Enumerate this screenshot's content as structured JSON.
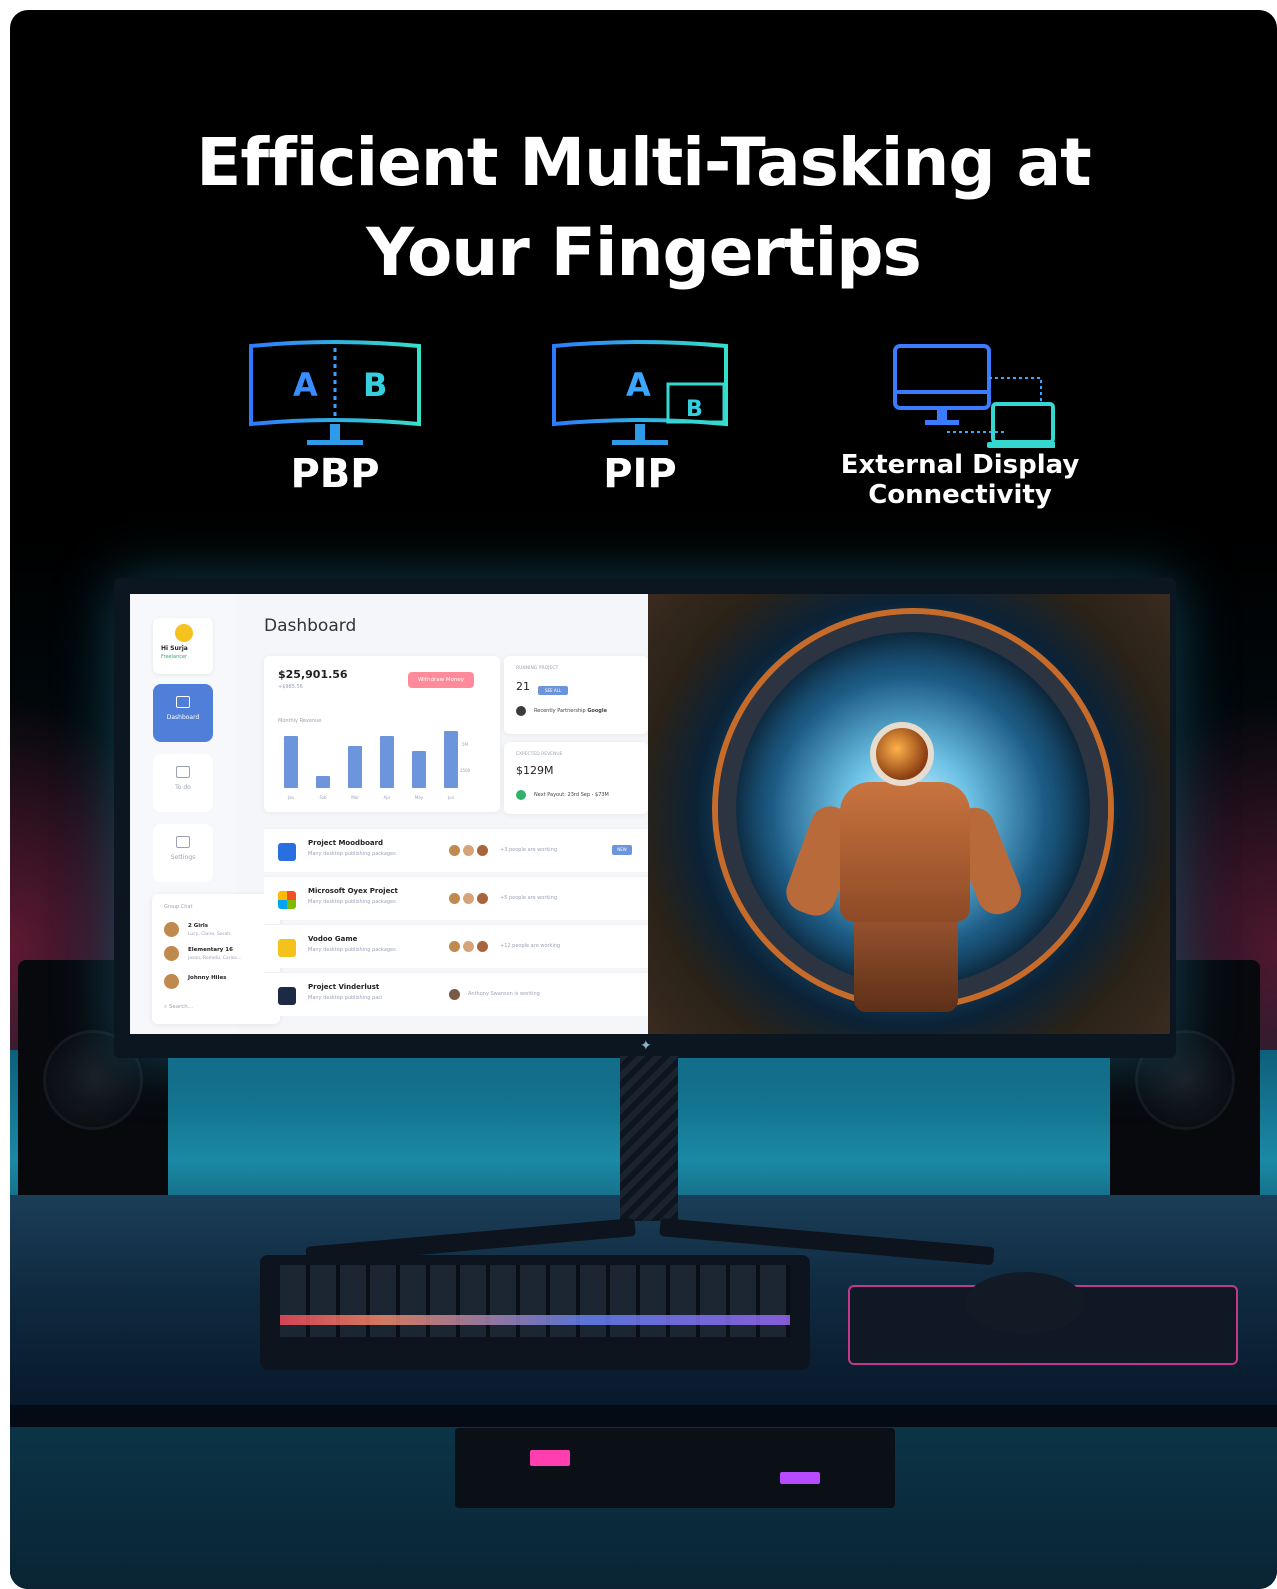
{
  "headline": {
    "line1": "Efficient Multi-Tasking at",
    "line2": "Your Fingertips"
  },
  "features": [
    {
      "label": "PBP",
      "icon": "pbp-split-monitor-icon",
      "letters": [
        "A",
        "B"
      ]
    },
    {
      "label": "PIP",
      "icon": "pip-monitor-icon",
      "letters": [
        "A",
        "B"
      ]
    },
    {
      "label_line1": "External Display",
      "label_line2": "Connectivity",
      "icon": "monitor-laptop-icon"
    }
  ],
  "colors": {
    "icon_gradient_start": "#2d7bff",
    "icon_gradient_end": "#35e0c8",
    "accent_blue": "#4f7fd8",
    "button_pink": "#ff8a9a"
  },
  "dashboard": {
    "profile_name": "Hi Surja",
    "profile_role": "Freelancer",
    "nav": [
      "Dashboard",
      "To do",
      "Settings"
    ],
    "title": "Dashboard",
    "balance": "$25,901.56",
    "balance_sub": "+$985.56",
    "withdraw_label": "Withdraw Money",
    "chart_label": "Monthly Revenue",
    "chart_months": [
      "Jan",
      "Feb",
      "Mar",
      "Apr",
      "May",
      "Jun"
    ],
    "chart_values": [
      52,
      12,
      42,
      52,
      37,
      57
    ],
    "chart_ticks": [
      "5M",
      "2500"
    ],
    "running_caption": "RUNNING PROJECT",
    "running_count": "21",
    "see_all": "SEE ALL",
    "partnership": "Recently Partnership",
    "partner_name": "Google",
    "revenue_caption": "EXPECTED REVENUE",
    "revenue_value": "$129M",
    "next_payout": "Next Payout: 23rd Sep - $73M",
    "projects": [
      {
        "title": "Project Moodboard",
        "sub": "Many desktop publishing packages",
        "people": "+3 people are working",
        "badge": "NEW"
      },
      {
        "title": "Microsoft Oyex Project",
        "sub": "Many desktop publishing packages",
        "people": "+5 people are working",
        "badge": ""
      },
      {
        "title": "Vodoo Game",
        "sub": "Many desktop publishing packages",
        "people": "+12 people are working",
        "badge": ""
      },
      {
        "title": "Project Vinderlust",
        "sub": "Many desktop publishing paci",
        "people": "Anthony Swanson is working",
        "badge": ""
      }
    ],
    "group_chat": {
      "title": "Group Chat",
      "rows": [
        {
          "name": "2 Girls",
          "sub": "Lucy, Claire, Sarah"
        },
        {
          "name": "Elementary 16",
          "sub": "Jason, Romelu, Carlos..."
        },
        {
          "name": "Johnny Hiles",
          "sub": ""
        }
      ],
      "search_placeholder": "Search..."
    }
  }
}
